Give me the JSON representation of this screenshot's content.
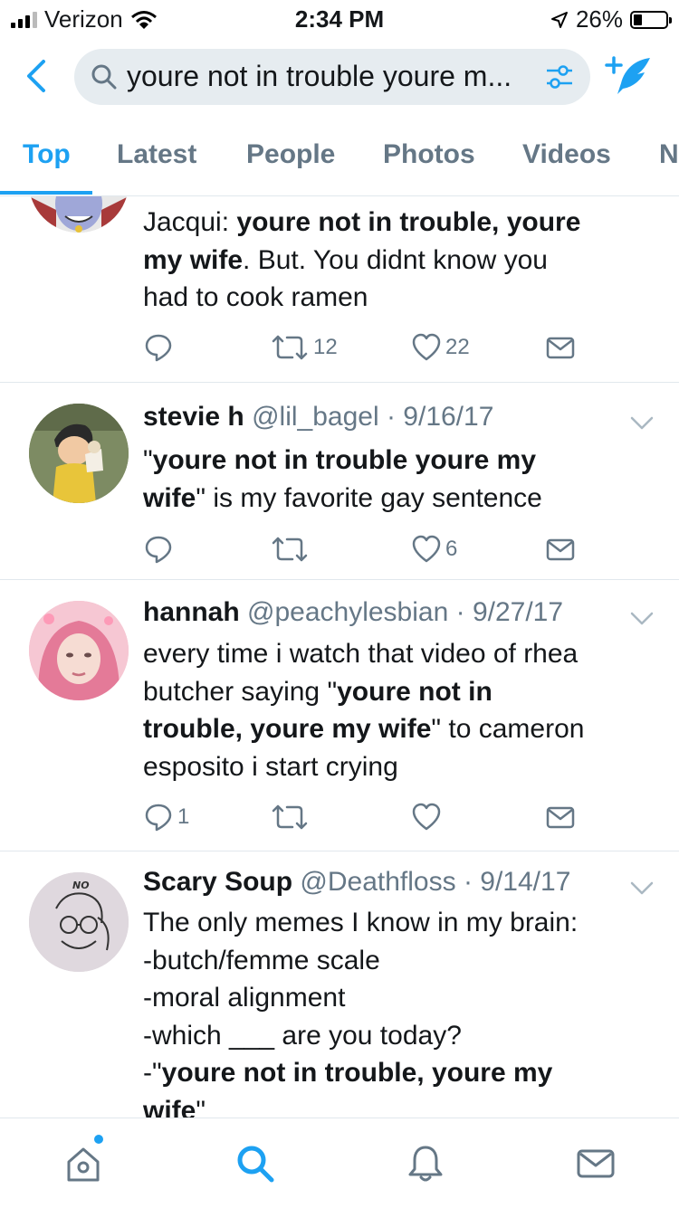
{
  "status": {
    "carrier": "Verizon",
    "time": "2:34 PM",
    "battery": "26%",
    "battery_level": 0.26
  },
  "search": {
    "query": "youre not in trouble youre m..."
  },
  "tabs": [
    "Top",
    "Latest",
    "People",
    "Photos",
    "Videos",
    "N"
  ],
  "colors": {
    "accent": "#1da1f2",
    "secondary_text": "#657786",
    "divider": "#e1e8ed"
  },
  "tweets": [
    {
      "body": [
        [
          "Jacqui: ",
          "youre not in trouble, youre",
          ""
        ],
        [
          "",
          "my wife",
          ". But. You didnt know you"
        ],
        [
          "had to cook ramen",
          "",
          ""
        ]
      ],
      "retweets": "12",
      "likes": "22"
    },
    {
      "name": "stevie h",
      "handle": "@lil_bagel",
      "date": "9/16/17",
      "body": [
        [
          "\"",
          "youre not in trouble youre my",
          ""
        ],
        [
          "",
          "wife",
          "\" is my favorite gay sentence"
        ]
      ],
      "likes": "6"
    },
    {
      "name": "hannah",
      "handle": "@peachylesbian",
      "date": "9/27/17",
      "body": [
        [
          "every time i watch that video of rhea",
          "",
          ""
        ],
        [
          "butcher saying \"",
          "youre not in",
          ""
        ],
        [
          "",
          "trouble, youre my wife",
          "\" to cameron"
        ],
        [
          "esposito i start crying",
          "",
          ""
        ]
      ],
      "replies": "1"
    },
    {
      "name": "Scary Soup",
      "handle": "@Deathfloss",
      "date": "9/14/17",
      "avatar_text": "NO",
      "body": [
        [
          "The only memes I know in my brain:",
          "",
          ""
        ],
        [
          "-butch/femme scale",
          "",
          ""
        ],
        [
          "-moral alignment",
          "",
          ""
        ],
        [
          "-which ___ are you today?",
          "",
          ""
        ],
        [
          "-\"",
          "youre not in trouble, youre my",
          ""
        ],
        [
          "",
          "wife",
          "\""
        ]
      ]
    }
  ],
  "icons": {
    "back": "chevron-left-icon",
    "search": "magnifier-icon",
    "filter": "sliders-icon",
    "compose": "compose-tweet-icon",
    "reply": "speech-bubble-icon",
    "retweet": "retweet-icon",
    "like": "heart-icon",
    "dm": "envelope-icon",
    "home": "home-icon",
    "explore": "search-icon",
    "notifications": "bell-icon",
    "messages": "envelope-icon"
  }
}
